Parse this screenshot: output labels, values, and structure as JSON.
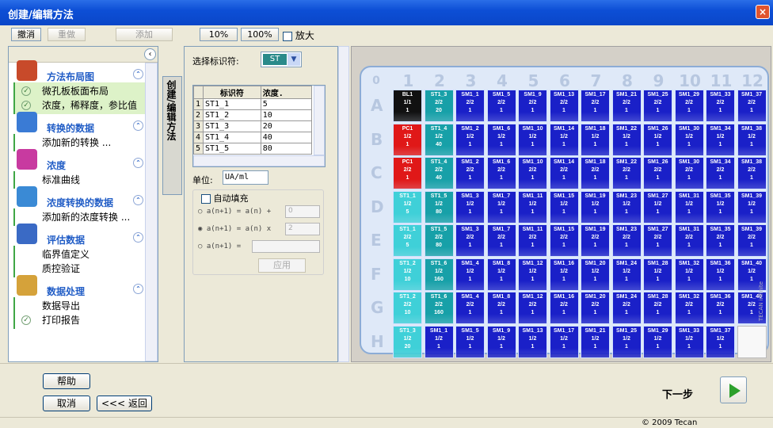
{
  "window": {
    "title": "创建/编辑方法",
    "close": "×"
  },
  "toolbar": {
    "undo": "撤消",
    "redo": "重做",
    "add": "添加",
    "zoom10": "10%",
    "zoom100": "100%",
    "zoom_in": "放大"
  },
  "left": {
    "sections": [
      {
        "title": "方法布局图",
        "items": [
          "微孔板板面布局",
          "浓度，稀释度，参比值"
        ]
      },
      {
        "title": "转换的数据",
        "items": [
          "添加新的转换 ..."
        ]
      },
      {
        "title": "浓度",
        "items": [
          "标准曲线"
        ]
      },
      {
        "title": "浓度转换的数据",
        "items": [
          "添加新的浓度转换 ..."
        ]
      },
      {
        "title": "评估数据",
        "items": [
          "临界值定义",
          "质控验证"
        ]
      },
      {
        "title": "数据处理",
        "items": [
          "数据导出",
          "打印报告"
        ]
      }
    ]
  },
  "vtab": "创建/编辑方法",
  "mid": {
    "select_label": "选择标识符:",
    "select_value": "ST",
    "col_id": "标识符",
    "col_conc": "浓度.",
    "rows": [
      [
        "1",
        "ST1_1",
        "5"
      ],
      [
        "2",
        "ST1_2",
        "10"
      ],
      [
        "3",
        "ST1_3",
        "20"
      ],
      [
        "4",
        "ST1_4",
        "40"
      ],
      [
        "5",
        "ST1_5",
        "80"
      ]
    ],
    "unit_label": "单位:",
    "unit_value": "UA/ml",
    "autofill": "自动填充",
    "f1": "a(n+1) = a(n) +",
    "f1v": "0",
    "f2": "a(n+1) = a(n) x",
    "f2v": "2",
    "f3": "a(n+1) =",
    "apply": "应用"
  },
  "plate": {
    "corner": "0",
    "cols": [
      "1",
      "2",
      "3",
      "4",
      "5",
      "6",
      "7",
      "8",
      "9",
      "10",
      "11",
      "12"
    ],
    "rows": [
      "A",
      "B",
      "C",
      "D",
      "E",
      "F",
      "G",
      "H"
    ],
    "watermark": "TECAN infinite",
    "wells": [
      [
        "BL1|1/1|1",
        "ST1_3|2/2|20",
        "SM1_1|2/2|1",
        "SM1_5|2/2|1",
        "SM1_9|2/2|1",
        "SM1_13|2/2|1",
        "SM1_17|2/2|1",
        "SM1_21|2/2|1",
        "SM1_25|2/2|1",
        "SM1_29|2/2|1",
        "SM1_33|2/2|1",
        "SM1_37|2/2|1"
      ],
      [
        "PC1|1/2|1",
        "ST1_4|1/2|40",
        "SM1_2|1/2|1",
        "SM1_6|1/2|1",
        "SM1_10|1/2|1",
        "SM1_14|1/2|1",
        "SM1_18|1/2|1",
        "SM1_22|1/2|1",
        "SM1_26|1/2|1",
        "SM1_30|1/2|1",
        "SM1_34|1/2|1",
        "SM1_38|1/2|1"
      ],
      [
        "PC1|2/2|1",
        "ST1_4|2/2|40",
        "SM1_2|2/2|1",
        "SM1_6|2/2|1",
        "SM1_10|2/2|1",
        "SM1_14|2/2|1",
        "SM1_18|2/2|1",
        "SM1_22|2/2|1",
        "SM1_26|2/2|1",
        "SM1_30|2/2|1",
        "SM1_34|2/2|1",
        "SM1_38|2/2|1"
      ],
      [
        "ST1_1|1/2|5",
        "ST1_5|1/2|80",
        "SM1_3|1/2|1",
        "SM1_7|1/2|1",
        "SM1_11|1/2|1",
        "SM1_15|1/2|1",
        "SM1_19|1/2|1",
        "SM1_23|1/2|1",
        "SM1_27|1/2|1",
        "SM1_31|1/2|1",
        "SM1_35|1/2|1",
        "SM1_39|1/2|1"
      ],
      [
        "ST1_1|2/2|5",
        "ST1_5|2/2|80",
        "SM1_3|2/2|1",
        "SM1_7|2/2|1",
        "SM1_11|2/2|1",
        "SM1_15|2/2|1",
        "SM1_19|2/2|1",
        "SM1_23|2/2|1",
        "SM1_27|2/2|1",
        "SM1_31|2/2|1",
        "SM1_35|2/2|1",
        "SM1_39|2/2|1"
      ],
      [
        "ST1_2|1/2|10",
        "ST1_6|1/2|160",
        "SM1_4|1/2|1",
        "SM1_8|1/2|1",
        "SM1_12|1/2|1",
        "SM1_16|1/2|1",
        "SM1_20|1/2|1",
        "SM1_24|1/2|1",
        "SM1_28|1/2|1",
        "SM1_32|1/2|1",
        "SM1_36|1/2|1",
        "SM1_40|1/2|1"
      ],
      [
        "ST1_2|2/2|10",
        "ST1_6|2/2|160",
        "SM1_4|2/2|1",
        "SM1_8|2/2|1",
        "SM1_12|2/2|1",
        "SM1_16|2/2|1",
        "SM1_20|2/2|1",
        "SM1_24|2/2|1",
        "SM1_28|2/2|1",
        "SM1_32|2/2|1",
        "SM1_36|2/2|1",
        "SM1_40|2/2|1"
      ],
      [
        "ST1_3|1/2|20",
        "SM1_1|1/2|1",
        "SM1_5|1/2|1",
        "SM1_9|1/2|1",
        "SM1_13|1/2|1",
        "SM1_17|1/2|1",
        "SM1_21|1/2|1",
        "SM1_25|1/2|1",
        "SM1_29|1/2|1",
        "SM1_33|1/2|1",
        "SM1_37|1/2|1",
        ""
      ]
    ]
  },
  "bottom": {
    "help": "帮助",
    "cancel": "取消",
    "back": "<<< 返回",
    "next": "下一步"
  },
  "status": {
    "copyright": "© 2009 Tecan"
  },
  "colors": {
    "title": "#0d4fd6",
    "sm": "#1a20c8",
    "st": "#17a0a8",
    "st_light": "#3fd0d8",
    "blank": "#111111",
    "pc": "#e01818"
  }
}
